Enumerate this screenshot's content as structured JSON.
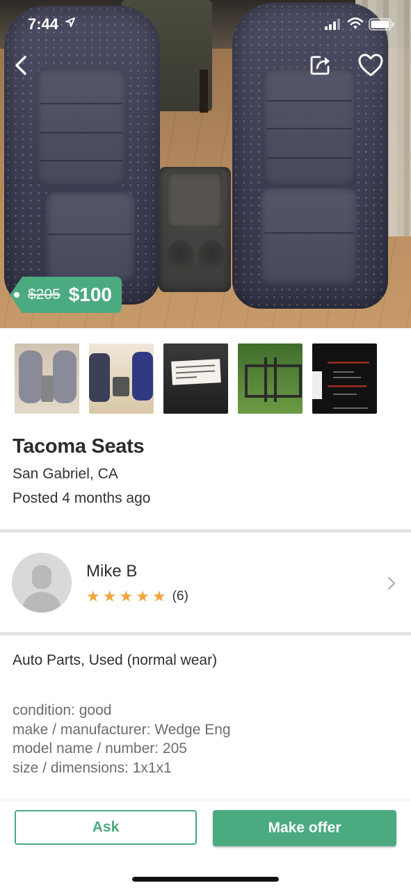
{
  "status_bar": {
    "time": "7:44"
  },
  "listing": {
    "original_price": "$205",
    "price": "$100",
    "title": "Tacoma Seats",
    "location": "San Gabriel, CA",
    "posted": "Posted 4 months ago",
    "photo_count": 5
  },
  "seller": {
    "name": "Mike B",
    "rating_stars": 5,
    "rating_count": "(6)"
  },
  "description": {
    "category": "Auto Parts, Used (normal wear)",
    "details": [
      "condition: good",
      "make / manufacturer: Wedge Eng",
      "model name / number: 205",
      "size / dimensions: 1x1x1"
    ]
  },
  "actions": {
    "ask_label": "Ask",
    "offer_label": "Make offer"
  },
  "colors": {
    "accent": "#4caa81",
    "star": "#f2a33b"
  },
  "icons": {
    "back": "chevron-left-icon",
    "share": "share-icon",
    "favorite": "heart-icon",
    "chevron": "chevron-right-icon"
  }
}
